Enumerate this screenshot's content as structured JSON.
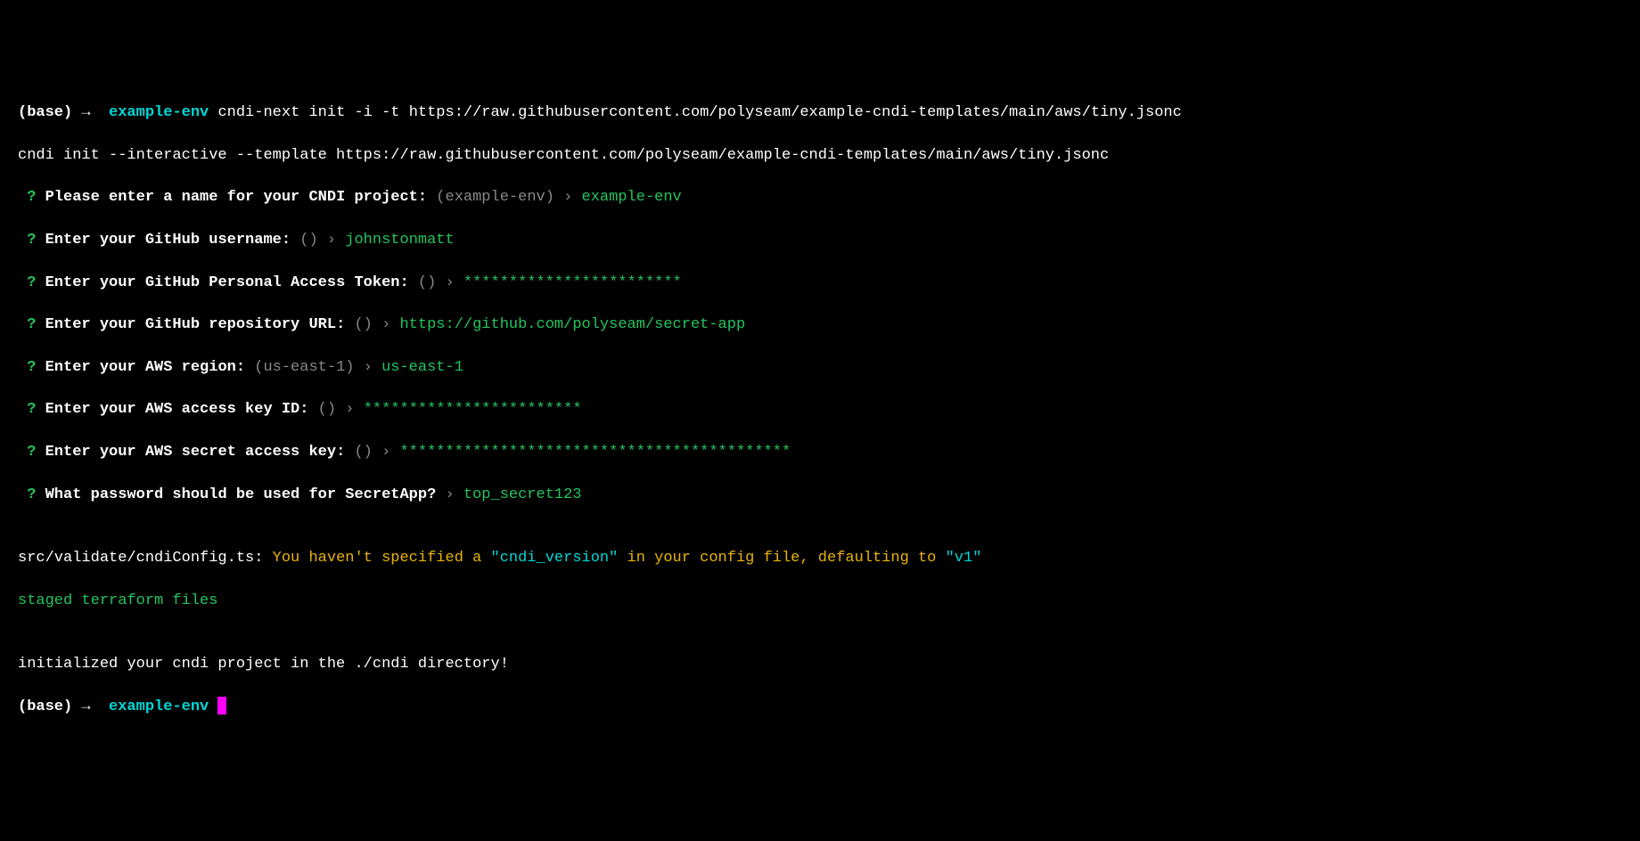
{
  "prompt1": {
    "base": "(base)",
    "arrow": "→",
    "env": "example-env",
    "command": "cndi-next init -i -t https://raw.githubusercontent.com/polyseam/example-cndi-templates/main/aws/tiny.jsonc"
  },
  "echoed_command": "cndi init --interactive --template https://raw.githubusercontent.com/polyseam/example-cndi-templates/main/aws/tiny.jsonc",
  "questions": [
    {
      "mark": "?",
      "text": "Please enter a name for your CNDI project:",
      "hint": "(example-env)",
      "angle": "›",
      "answer": "example-env"
    },
    {
      "mark": "?",
      "text": "Enter your GitHub username:",
      "hint": "()",
      "angle": "›",
      "answer": "johnstonmatt"
    },
    {
      "mark": "?",
      "text": "Enter your GitHub Personal Access Token:",
      "hint": "()",
      "angle": "›",
      "answer": "************************"
    },
    {
      "mark": "?",
      "text": "Enter your GitHub repository URL:",
      "hint": "()",
      "angle": "›",
      "answer": "https://github.com/polyseam/secret-app"
    },
    {
      "mark": "?",
      "text": "Enter your AWS region:",
      "hint": "(us-east-1)",
      "angle": "›",
      "answer": "us-east-1"
    },
    {
      "mark": "?",
      "text": "Enter your AWS access key ID:",
      "hint": "()",
      "angle": "›",
      "answer": "************************"
    },
    {
      "mark": "?",
      "text": "Enter your AWS secret access key:",
      "hint": "()",
      "angle": "›",
      "answer": "*******************************************"
    },
    {
      "mark": "?",
      "text": "What password should be used for SecretApp?",
      "hint": "",
      "angle": "›",
      "answer": "top_secret123"
    }
  ],
  "warning": {
    "prefix": "src/validate/cndiConfig.ts:",
    "part1": "You haven't specified a",
    "quoted": "\"cndi_version\"",
    "part2": "in your config file, defaulting to",
    "quoted2": "\"v1\""
  },
  "staged": "staged terraform files",
  "initialized": "initialized your cndi project in the ./cndi directory!",
  "prompt2": {
    "base": "(base)",
    "arrow": "→",
    "env": "example-env"
  }
}
